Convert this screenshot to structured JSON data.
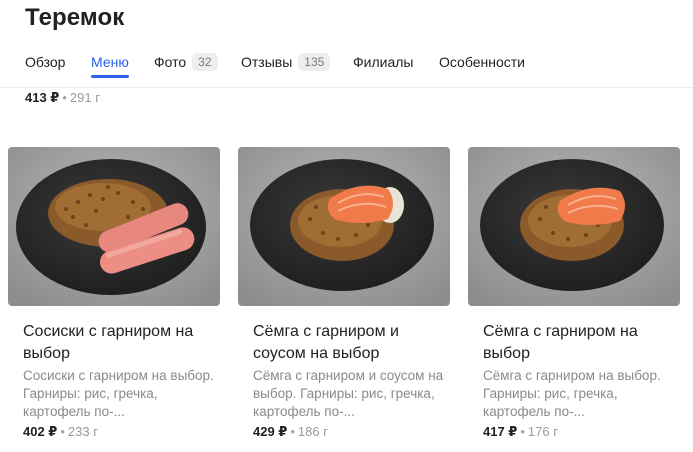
{
  "title": "Теремок",
  "tabs": [
    {
      "label": "Обзор",
      "count": ""
    },
    {
      "label": "Меню",
      "count": ""
    },
    {
      "label": "Фото",
      "count": "32"
    },
    {
      "label": "Отзывы",
      "count": "135"
    },
    {
      "label": "Филиалы",
      "count": ""
    },
    {
      "label": "Особенности",
      "count": ""
    }
  ],
  "active_tab": "Меню",
  "accent_color": "#2b61ec",
  "top_item": {
    "price": "413 ₽",
    "weight": "291 г"
  },
  "items": [
    {
      "name": "Сосиски с гарниром на выбор",
      "description": "Сосиски с гарниром на выбор. Гарниры: рис, гречка, картофель по-...",
      "price": "402 ₽",
      "weight": "233 г"
    },
    {
      "name": "Сёмга с гарниром и соусом на выбор",
      "description": "Сёмга с гарниром и соусом на выбор. Гарниры: рис, гречка, картофель по-...",
      "price": "429 ₽",
      "weight": "186 г"
    },
    {
      "name": "Сёмга с гарниром на выбор",
      "description": "Сёмга с гарниром на выбор. Гарниры: рис, гречка, картофель по-...",
      "price": "417 ₽",
      "weight": "176 г"
    }
  ]
}
